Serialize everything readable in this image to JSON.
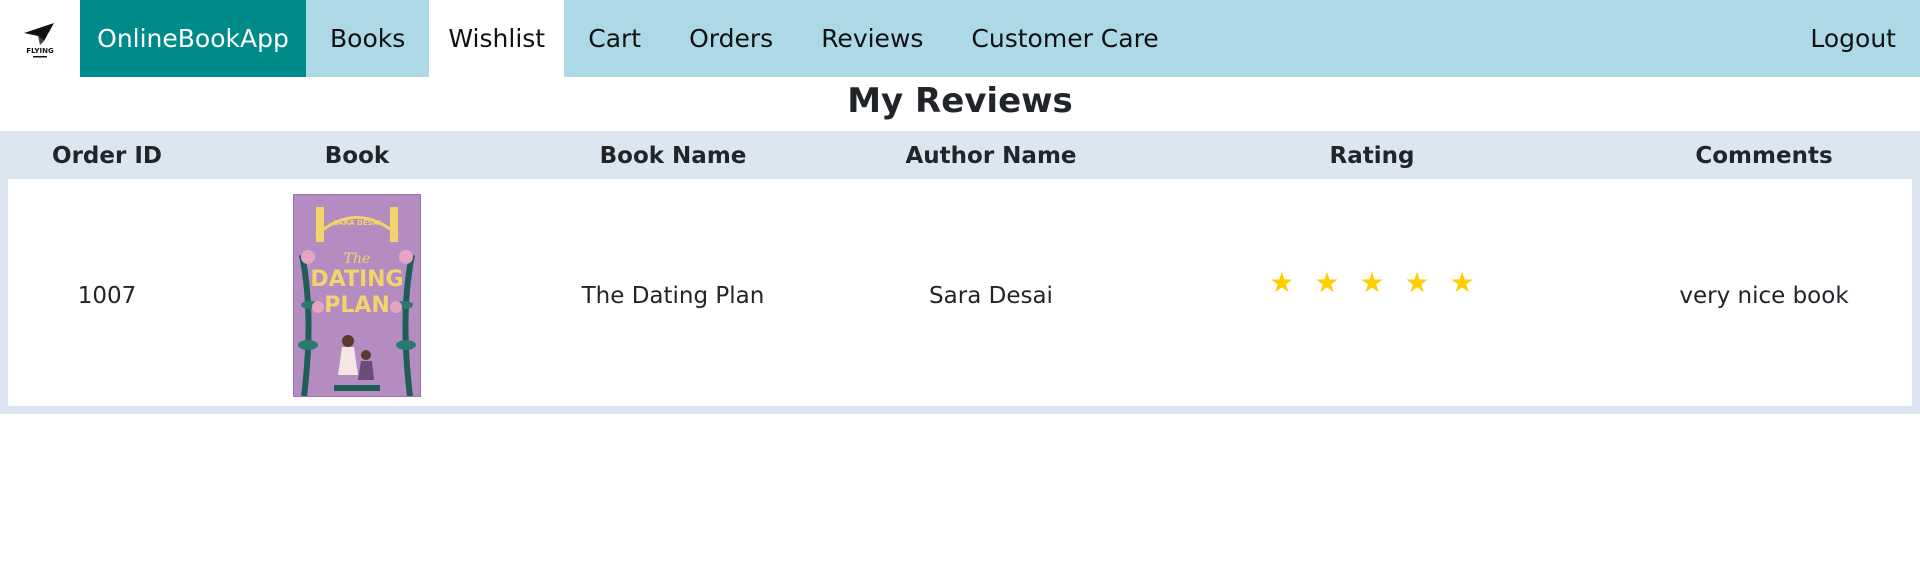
{
  "nav": {
    "logo_text": "FLYING",
    "brand": "OnlineBookApp",
    "items": [
      {
        "label": "Books",
        "active": false
      },
      {
        "label": "Wishlist",
        "active": true
      },
      {
        "label": "Cart",
        "active": false
      },
      {
        "label": "Orders",
        "active": false
      },
      {
        "label": "Reviews",
        "active": false
      },
      {
        "label": "Customer Care",
        "active": false
      }
    ],
    "logout": "Logout"
  },
  "page": {
    "title": "My Reviews"
  },
  "table": {
    "headers": [
      "Order ID",
      "Book",
      "Book Name",
      "Author Name",
      "Rating",
      "Comments"
    ],
    "rows": [
      {
        "order_id": "1007",
        "cover_title_line1": "The",
        "cover_title_line2": "DATING",
        "cover_title_line3": "PLAN",
        "cover_author": "SARA DESAI",
        "book_name": "The Dating Plan",
        "author_name": "Sara Desai",
        "rating": 5,
        "comments": "very nice book"
      }
    ]
  },
  "colors": {
    "navbar": "#add8e6",
    "brand": "#008b8b",
    "table_bg": "#dce6f1",
    "star": "#ffd000"
  }
}
